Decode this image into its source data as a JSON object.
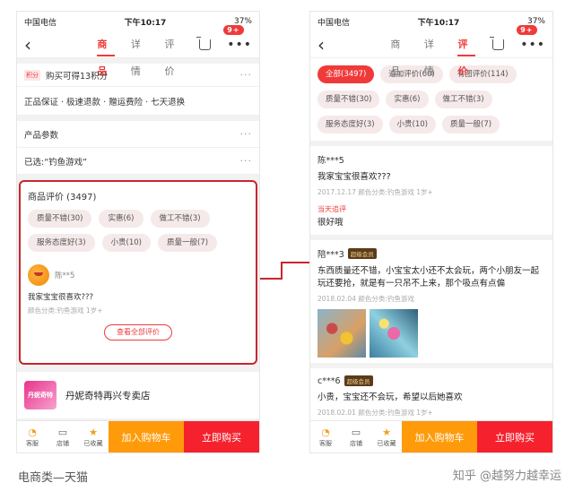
{
  "caption": "电商类—天猫",
  "watermark": "知乎 @越努力越幸运",
  "status": {
    "carrier": "中国电信",
    "time": "下午10:17",
    "battery": "37%"
  },
  "left": {
    "tabs": [
      "商品",
      "详情",
      "评价"
    ],
    "badge": "9+",
    "points_tag": "积分",
    "points_text": "购买可得13积分",
    "services": "正品保证 · 极速退款 · 赠运费险 · 七天退换",
    "params_label": "产品参数",
    "selected_label": "已选:“钓鱼游戏”",
    "review_title": "商品评价 (3497)",
    "chips": [
      "质量不错(30)",
      "实惠(6)",
      "做工不错(3)",
      "服务态度好(3)",
      "小贵(10)",
      "质量一般(7)"
    ],
    "user": "陈**5",
    "review_text": "我家宝宝很喜欢???",
    "review_meta": "颜色分类:钓鱼游戏   1岁+",
    "all_button": "查看全部评价",
    "shop_logo_text": "丹妮奇特",
    "shop_name": "丹妮奇特再兴专卖店",
    "bottom": {
      "service": "客服",
      "store": "店铺",
      "fav": "已收藏",
      "add_cart": "加入购物车",
      "buy": "立即购买"
    }
  },
  "right": {
    "tabs": [
      "商品",
      "详情",
      "评价"
    ],
    "badge": "9+",
    "chips": [
      "全部(3497)",
      "追加评价(60)",
      "有图评价(114)",
      "质量不错(30)",
      "实惠(6)",
      "做工不错(3)",
      "服务态度好(3)",
      "小贵(10)",
      "质量一般(7)"
    ],
    "reviews": [
      {
        "name": "陈***5",
        "vip": "",
        "text": "我家宝宝很喜欢???",
        "meta": "2017.12.17  颜色分类:钓鱼游戏   1岁+",
        "add_label": "当天追评",
        "add_text": "很好哦"
      },
      {
        "name": "陪***3",
        "vip": "超级会员",
        "text": "东西质量还不错，小宝宝太小还不太会玩，两个小朋友一起玩还要抢，就是有一只吊不上来，那个吸点有点偏",
        "meta": "2018.02.04  颜色分类:钓鱼游戏"
      },
      {
        "name": "c***6",
        "vip": "超级会员",
        "text": "小贵，宝宝还不会玩，希望以后她喜欢",
        "meta": "2018.02.01  颜色分类:钓鱼游戏   1岁+"
      }
    ],
    "bottom": {
      "service": "客服",
      "store": "店铺",
      "fav": "已收藏",
      "add_cart": "加入购物车",
      "buy": "立即购买"
    }
  }
}
